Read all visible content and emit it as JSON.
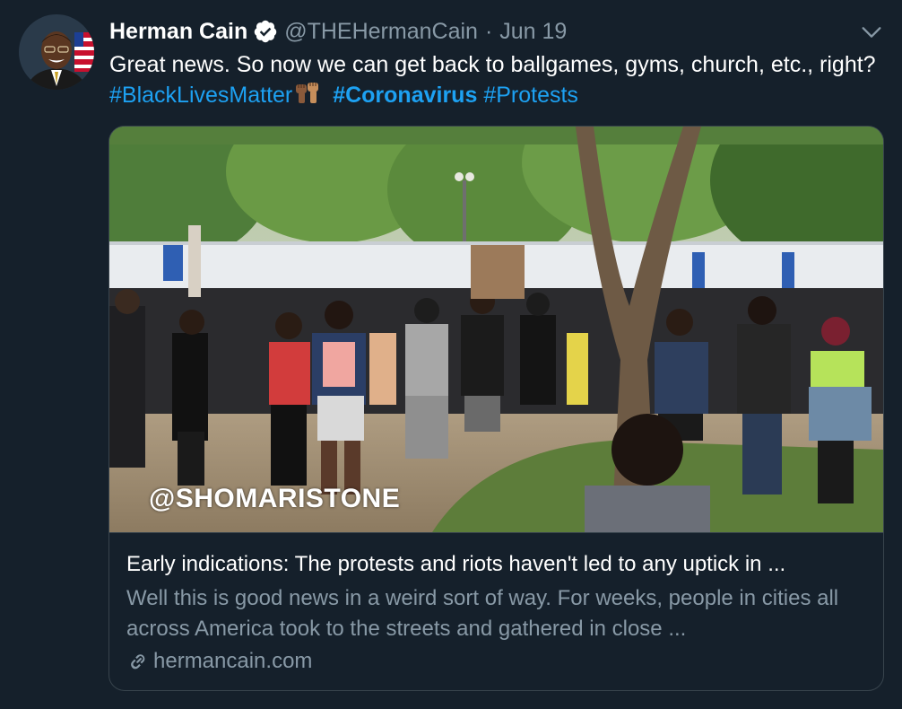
{
  "tweet": {
    "name": "Herman Cain",
    "handle": "@THEHermanCain",
    "separator": "·",
    "date": "Jun 19",
    "text_before": "Great news. So now we can get back to ballgames, gyms, church, etc., right?",
    "hashtags": [
      "#BlackLivesMatter",
      "#Coronavirus",
      "#Protests"
    ]
  },
  "card": {
    "watermark": "@SHOMARISTONE",
    "title": "Early indications: The protests and riots haven't led to any uptick in ...",
    "description": "Well this is good news in a weird sort of way. For weeks, people in cities all across America took to the streets and gathered in close ...",
    "domain": "hermancain.com"
  },
  "colors": {
    "background": "#15202b",
    "accent": "#1da1f2",
    "secondary_text": "#8899a6",
    "border": "#38444d"
  },
  "icons": [
    "verified-badge-icon",
    "chevron-down-icon",
    "raised-fists-emoji",
    "link-icon"
  ]
}
